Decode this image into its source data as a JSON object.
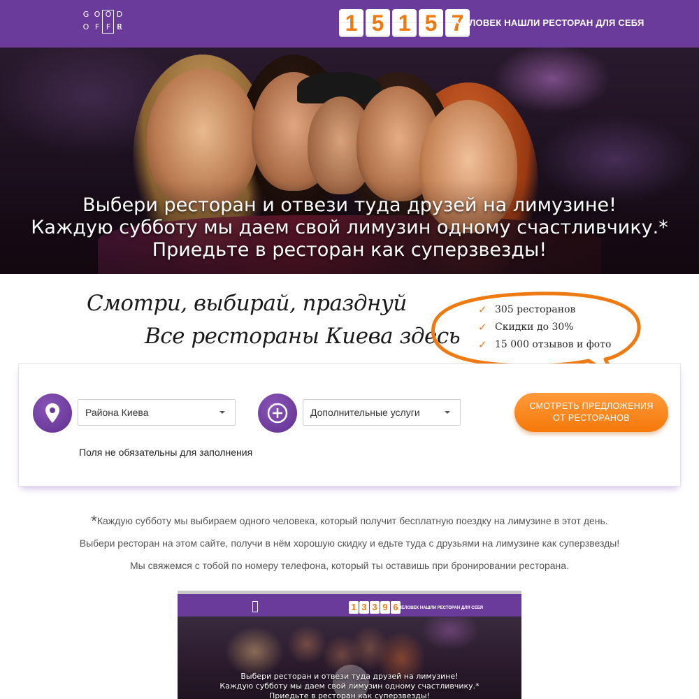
{
  "header": {
    "logo_letters": [
      "G",
      "O",
      "O",
      "D",
      "O",
      "F",
      "F",
      "E",
      "R"
    ],
    "counter_digits": [
      "1",
      "5",
      "1",
      "5",
      "7"
    ],
    "counter_label": "ЧЕЛОВЕК НАШЛИ РЕСТОРАН ДЛЯ СЕБЯ"
  },
  "hero": {
    "line1": "Выбери ресторан и отвези туда друзей на лимузине!",
    "line2": "Каждую субботу мы даем свой лимузин одному счастливчику.*",
    "line3": "Приедьте в ресторан как суперзвезды!"
  },
  "slogan": {
    "line1": "Смотри, выбирай, празднуй",
    "line2": "Все рестораны Киева здесь"
  },
  "bubble": {
    "items": [
      "305 ресторанов",
      "Скидки до 30%",
      "15 000 отзывов и фото"
    ],
    "accent": "#f07a12"
  },
  "search": {
    "district_select": "Района Киева",
    "services_select": "Дополнительные услуги",
    "cta_line1": "СМОТРЕТЬ ПРЕДЛОЖЕНИЯ",
    "cta_line2": "ОТ РЕСТОРАНОВ",
    "note": "Поля не обязательны для заполнения"
  },
  "footnote": {
    "star": "*",
    "line1": "Каждую субботу мы выбираем одного человека, который получит бесплатную поездку на лимузине в этот день.",
    "line2": "Выбери ресторан на этом сайте, получи в нём хорошую скидку и едьте туда с друзьями на лимузине как суперзвезды!",
    "line3": "Мы свяжемся с тобой по номеру телефона, который ты оставишь при бронировании ресторана."
  },
  "preview": {
    "counter_digits": [
      "1",
      "3",
      "3",
      "9",
      "6"
    ],
    "counter_label": "ЧЕЛОВЕК НАШЛИ РЕСТОРАН ДЛЯ СЕБЯ",
    "line1": "Выбери ресторан и отвези туда друзей на лимузине!",
    "line2": "Каждую субботу мы даем свой лимузин одному счастливчику.*",
    "line3": "Приедьте в ресторан как суперзвезды!"
  },
  "colors": {
    "brand_purple": "#6a3b9a",
    "accent_orange": "#f07a12"
  }
}
